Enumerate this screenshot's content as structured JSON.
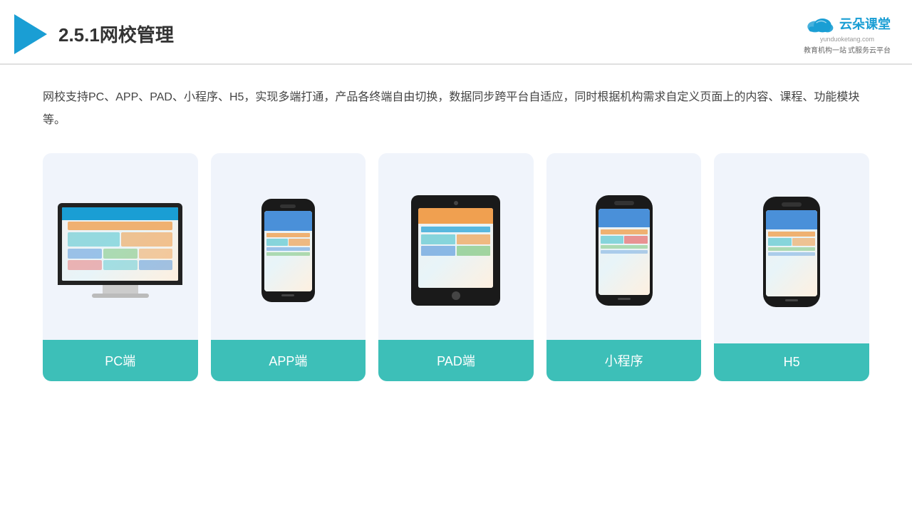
{
  "header": {
    "title": "2.5.1网校管理",
    "brand": {
      "name": "云朵课堂",
      "url": "yunduoketang.com",
      "tagline": "教育机构一站",
      "tagline2": "式服务云平台"
    }
  },
  "description": {
    "text": "网校支持PC、APP、PAD、小程序、H5，实现多端打通，产品各终端自由切换，数据同步跨平台自适应，同时根据机构需求自定义页面上的内容、课程、功能模块等。"
  },
  "cards": [
    {
      "id": "pc",
      "label": "PC端"
    },
    {
      "id": "app",
      "label": "APP端"
    },
    {
      "id": "pad",
      "label": "PAD端"
    },
    {
      "id": "miniapp",
      "label": "小程序"
    },
    {
      "id": "h5",
      "label": "H5"
    }
  ]
}
